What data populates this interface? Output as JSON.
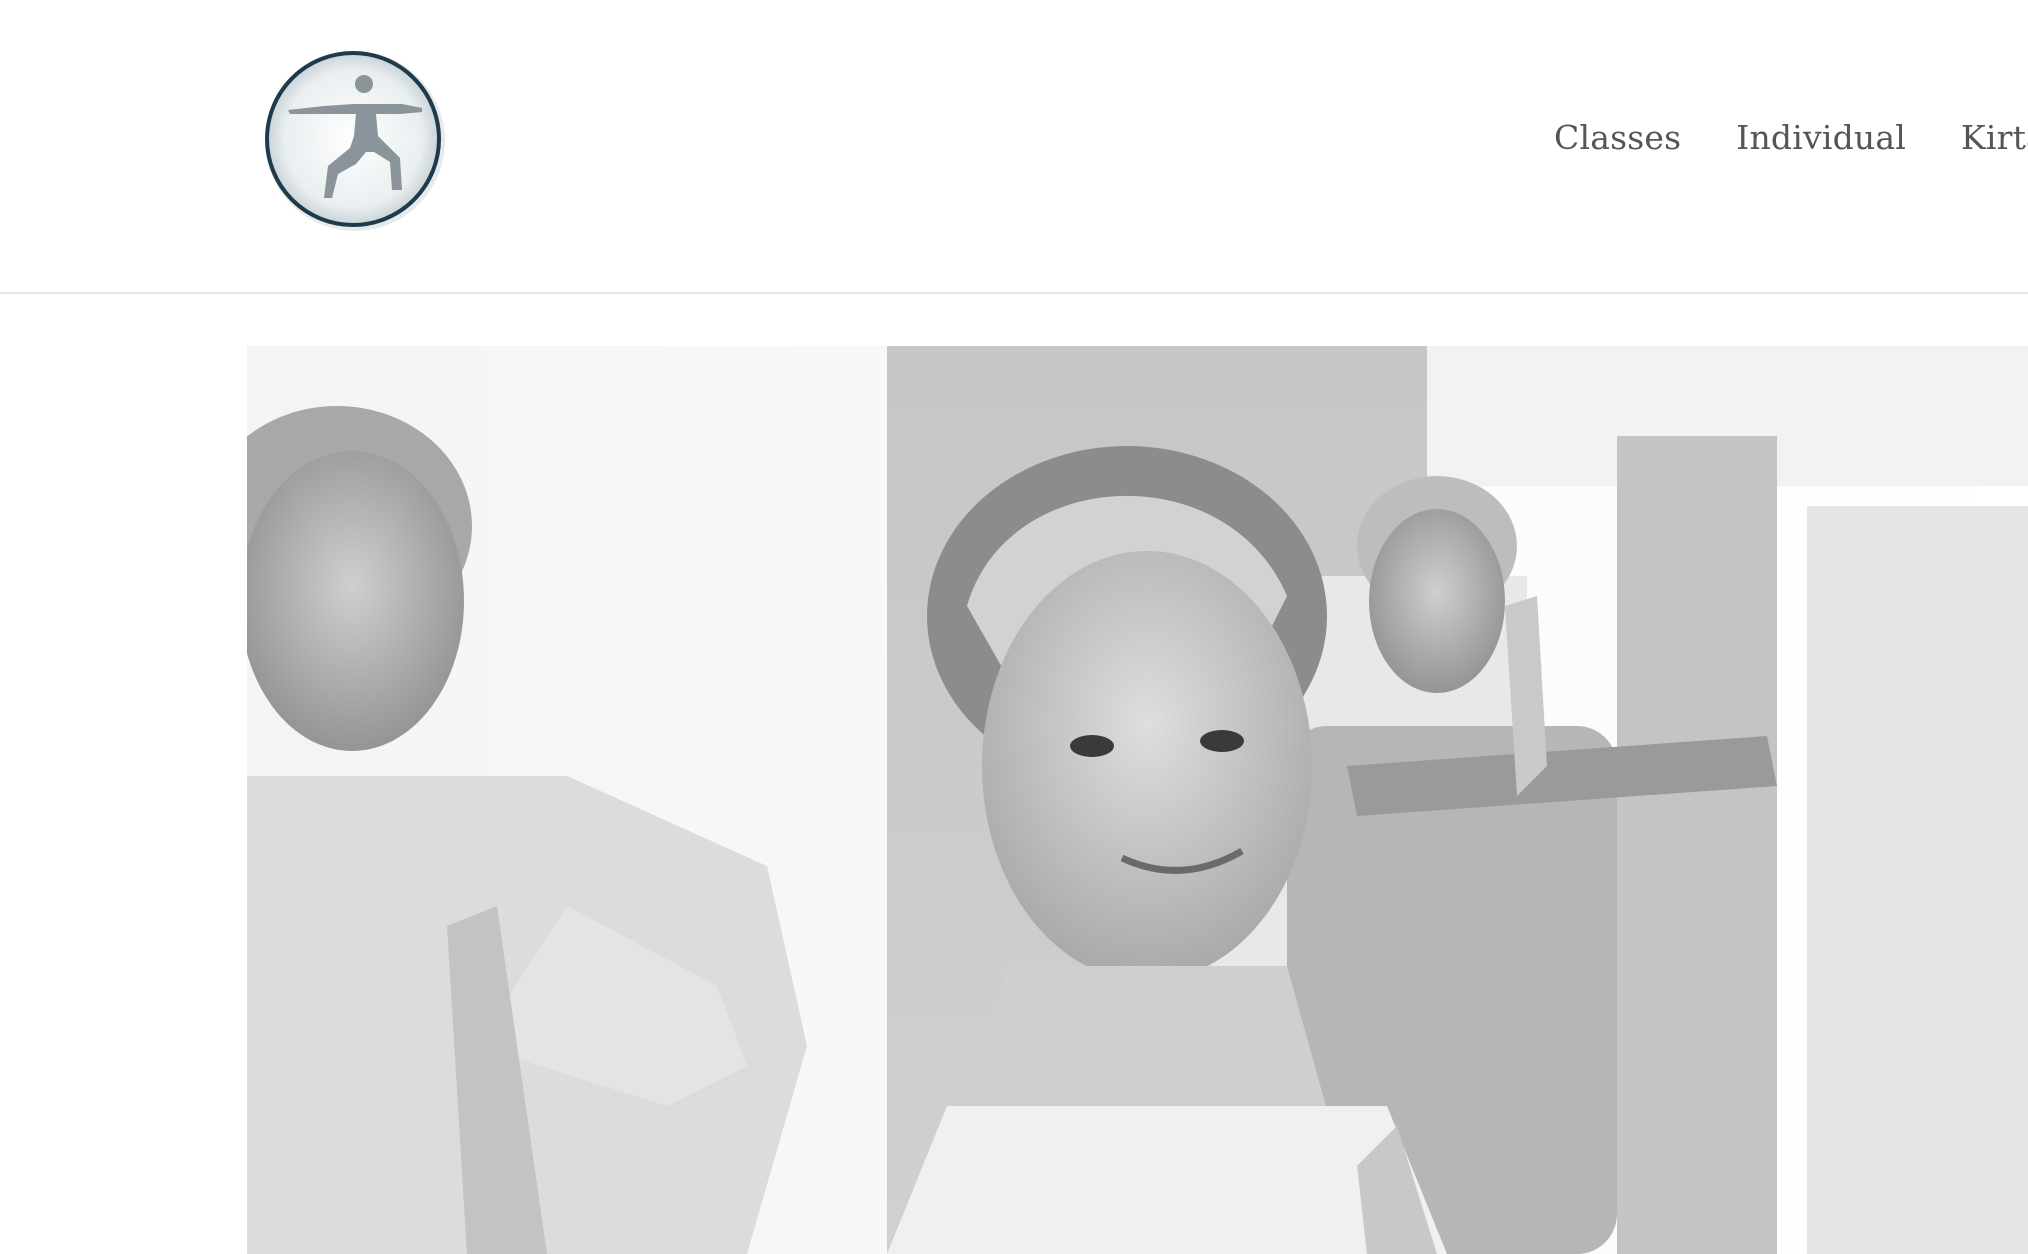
{
  "header": {
    "logo": {
      "icon": "yoga-warrior-pose-logo",
      "interactable": true
    },
    "nav": [
      {
        "label": "Classes"
      },
      {
        "label": "Individual"
      },
      {
        "label": "Kirtan"
      }
    ]
  },
  "hero": {
    "image": "black-and-white photo of seniors in prayer pose doing yoga"
  },
  "colors": {
    "nav_text": "#555555",
    "header_border": "#e4e4e4",
    "logo_ring": "#1f3a4a"
  }
}
